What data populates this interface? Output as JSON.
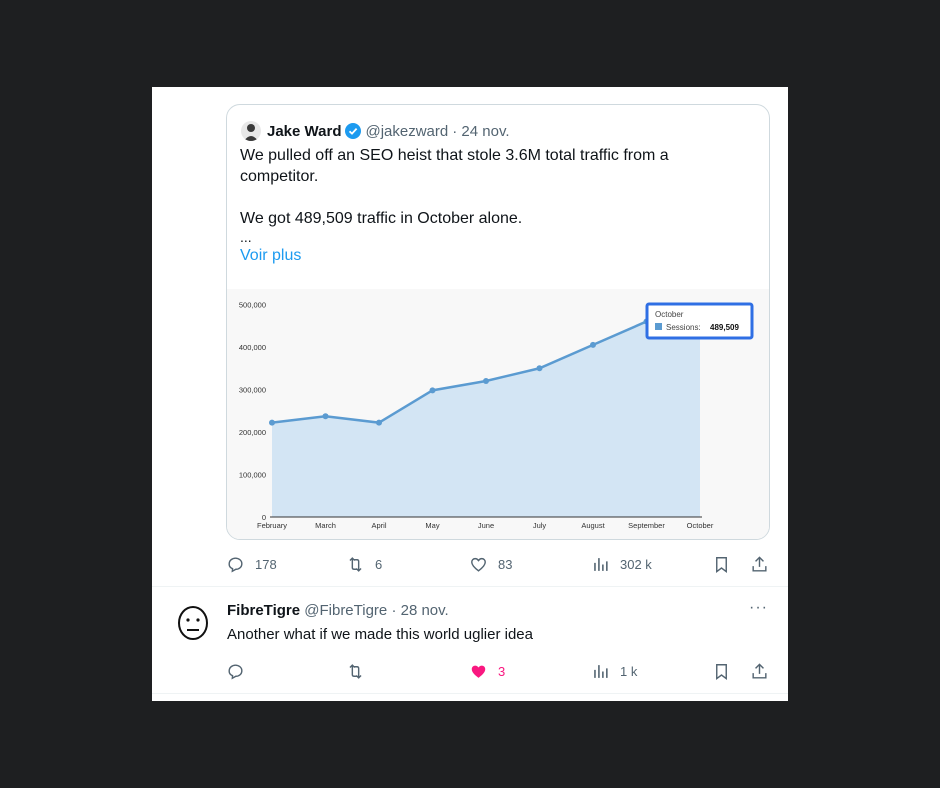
{
  "quoted_tweet": {
    "author_name": "Jake Ward",
    "handle": "@jakezward",
    "date": "· 24 nov.",
    "text_line1": "We pulled off an SEO heist that stole 3.6M total traffic from a",
    "text_line2": "competitor.",
    "text_line3": "We got 489,509 traffic in October alone.",
    "ellipsis": "...",
    "show_more": "Voir plus"
  },
  "chart_data": {
    "type": "area",
    "categories": [
      "February",
      "March",
      "April",
      "May",
      "June",
      "July",
      "August",
      "September",
      "October"
    ],
    "series": [
      {
        "name": "Sessions",
        "values": [
          222000,
          237000,
          222000,
          298000,
          320000,
          350000,
          405000,
          460000,
          489509
        ]
      }
    ],
    "y_ticks": [
      "0",
      "100,000",
      "200,000",
      "300,000",
      "400,000",
      "500,000"
    ],
    "ylim": [
      0,
      520000
    ],
    "grid": false,
    "tooltip": {
      "title": "October",
      "label": "Sessions:",
      "value": "489,509",
      "highlight_color": "#2f6fe4"
    },
    "colors": {
      "line": "#5b9bd1",
      "fill": "#d3e5f4"
    }
  },
  "tweet_actions": {
    "replies": "178",
    "retweets": "6",
    "likes": "83",
    "views": "302 k"
  },
  "reply": {
    "author_name": "FibreTigre",
    "handle": "@FibreTigre",
    "date": "· 28 nov.",
    "text": "Another what if we made this world uglier idea",
    "more": "···",
    "actions": {
      "likes": "3",
      "views": "1 k"
    },
    "like_color": "#f91880"
  },
  "icons": [
    "reply-icon",
    "retweet-icon",
    "like-icon",
    "views-icon",
    "bookmark-icon",
    "share-icon",
    "verified-icon"
  ]
}
